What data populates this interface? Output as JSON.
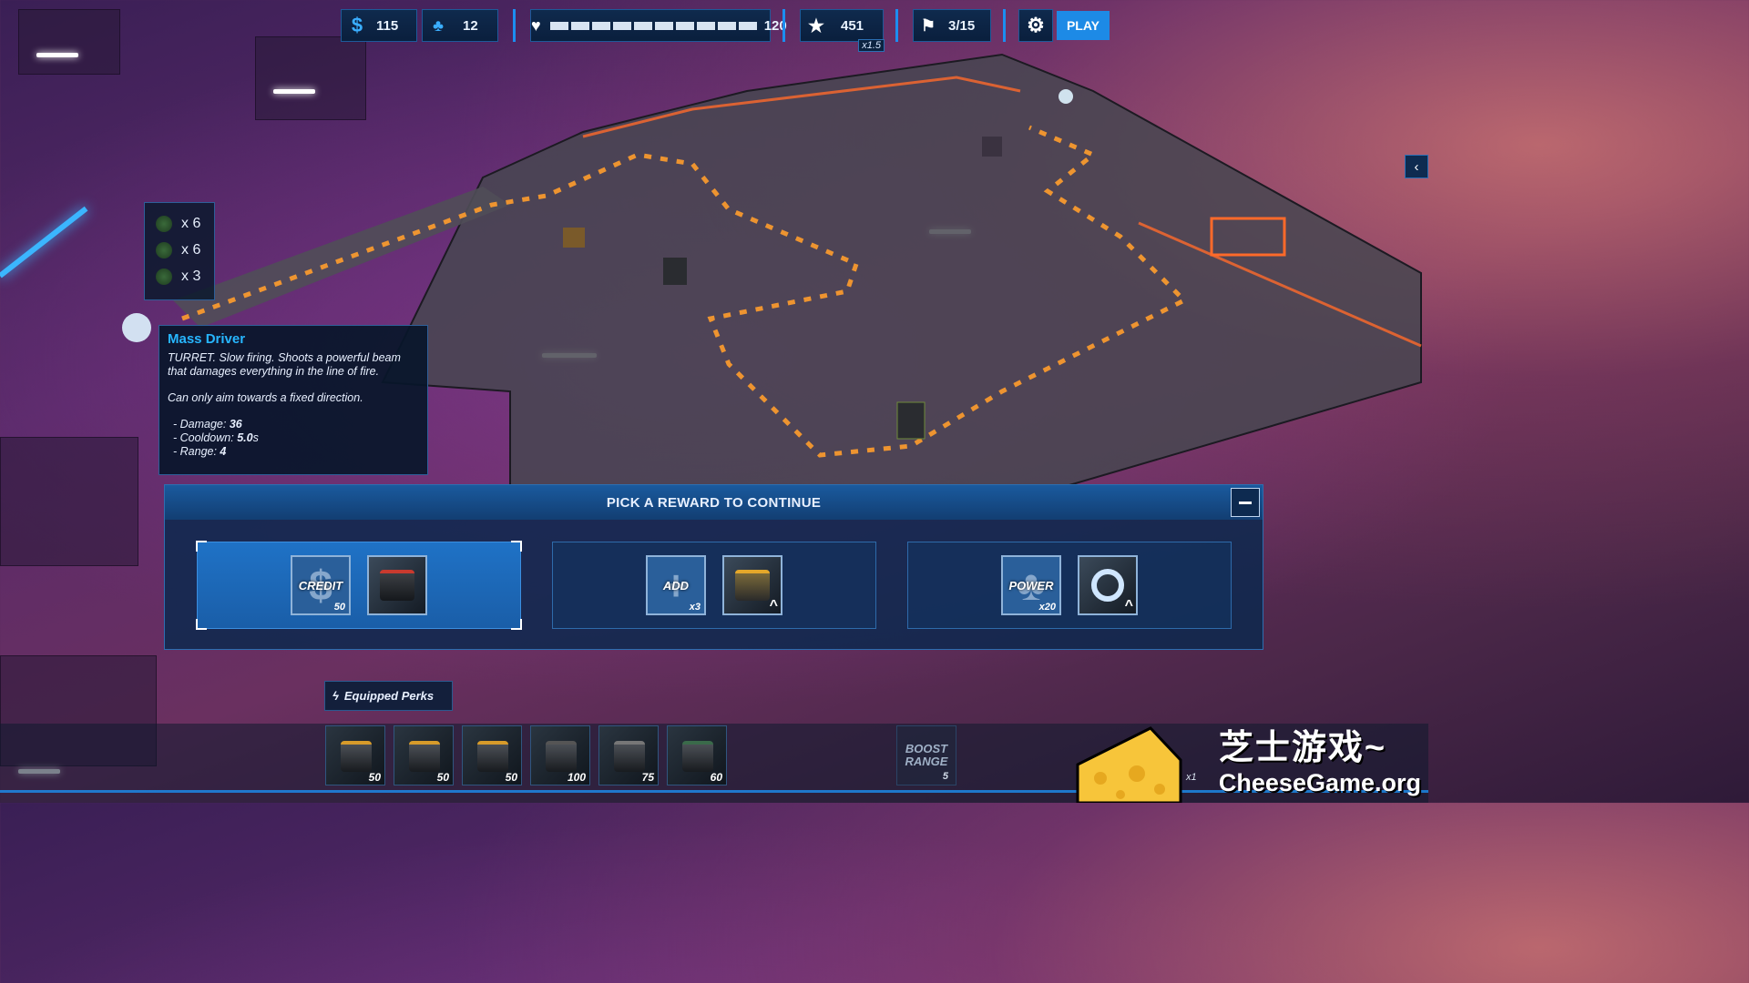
{
  "hud": {
    "credits": "115",
    "power": "12",
    "health_value": "120",
    "health_segments": 10,
    "score": "451",
    "multiplier": "x1.5",
    "wave": "3/15",
    "play_label": "PLAY"
  },
  "wave_enemies": [
    {
      "count": "x 6"
    },
    {
      "count": "x 6"
    },
    {
      "count": "x 3"
    }
  ],
  "tooltip": {
    "title": "Mass Driver",
    "line1": "TURRET.   Slow firing. Shoots a powerful beam",
    "line2": "that damages everything in the line of fire.",
    "line3": "Can only aim towards a fixed direction.",
    "damage_label": "- Damage: ",
    "damage": "36",
    "cooldown_label": "- Cooldown: ",
    "cooldown": "5.0",
    "cooldown_unit": "s",
    "range_label": "- Range: ",
    "range": "4"
  },
  "reward": {
    "title": "PICK A REWARD TO CONTINUE",
    "options": [
      {
        "card1_label": "CREDIT",
        "card1_value": "50",
        "card2": "turret"
      },
      {
        "card1_label": "ADD",
        "card1_value": "x3",
        "card2": "turret-upgrade"
      },
      {
        "card1_label": "POWER",
        "card1_value": "x20",
        "card2": "gear-upgrade"
      }
    ]
  },
  "perks": {
    "tab_label": "Equipped Perks",
    "slots": [
      {
        "cost": "50"
      },
      {
        "cost": "50"
      },
      {
        "cost": "50"
      },
      {
        "cost": "100"
      },
      {
        "cost": "75"
      },
      {
        "cost": "60"
      }
    ],
    "boost_label_1": "BOOST",
    "boost_label_2": "RANGE",
    "boost_cost": "5",
    "x1": "x1"
  },
  "watermark": {
    "zh": "芝士游戏~",
    "en": "CheeseGame.org"
  },
  "colors": {
    "accent": "#1c8ef0",
    "title_blue": "#27b6ff",
    "panel": "#0c284e"
  }
}
